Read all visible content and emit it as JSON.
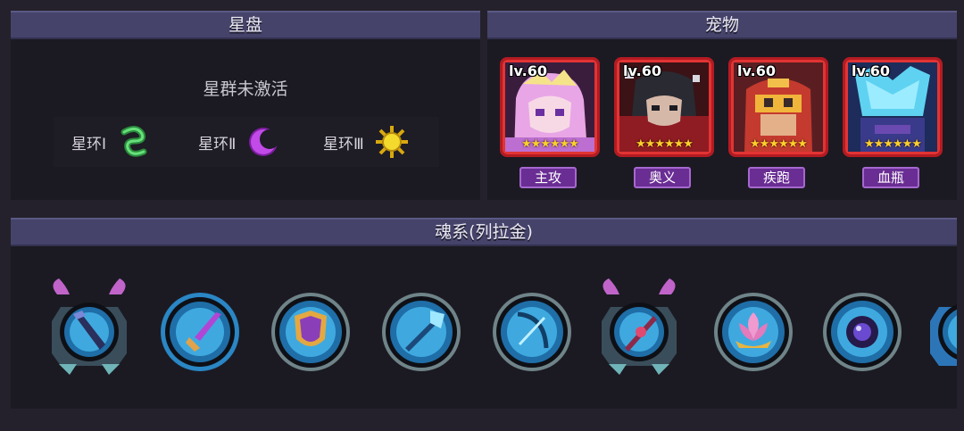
{
  "star_disk": {
    "title": "星盘",
    "status": "星群未激活",
    "rings": [
      {
        "label": "星环Ⅰ",
        "icon": "green-swirl-ring-icon",
        "color": "#3fc25a"
      },
      {
        "label": "星环Ⅱ",
        "icon": "purple-crescent-ring-icon",
        "color": "#b23ad8"
      },
      {
        "label": "星环Ⅲ",
        "icon": "yellow-sun-ring-icon",
        "color": "#f0d21e"
      }
    ]
  },
  "pets": {
    "title": "宠物",
    "items": [
      {
        "level": "lv.60",
        "stars": "★★★★★★",
        "role": "主攻",
        "icon": "pink-haired-girl-portrait"
      },
      {
        "level": "lv.60",
        "stars": "★★★★★★",
        "role": "奥义",
        "icon": "dark-haired-swordsman-portrait"
      },
      {
        "level": "lv.60",
        "stars": "★★★★★★",
        "role": "疾跑",
        "icon": "red-robot-portrait"
      },
      {
        "level": "lv.60",
        "stars": "★★★★★★",
        "role": "血瓶",
        "icon": "blue-spirit-portrait"
      }
    ]
  },
  "soul": {
    "title": "魂系(列拉金)",
    "skills": [
      {
        "icon": "dark-sword-skill-icon",
        "frame": "ornate"
      },
      {
        "icon": "purple-dagger-skill-icon",
        "frame": "blue-ring"
      },
      {
        "icon": "golden-shield-skill-icon",
        "frame": "plain"
      },
      {
        "icon": "crystal-staff-skill-icon",
        "frame": "plain"
      },
      {
        "icon": "blue-bow-skill-icon",
        "frame": "plain"
      },
      {
        "icon": "crimson-blade-skill-icon",
        "frame": "ornate"
      },
      {
        "icon": "pink-lotus-skill-icon",
        "frame": "plain"
      },
      {
        "icon": "dark-orb-skill-icon",
        "frame": "plain"
      },
      {
        "icon": "blue-crest-skill-icon",
        "frame": "partial"
      }
    ]
  }
}
